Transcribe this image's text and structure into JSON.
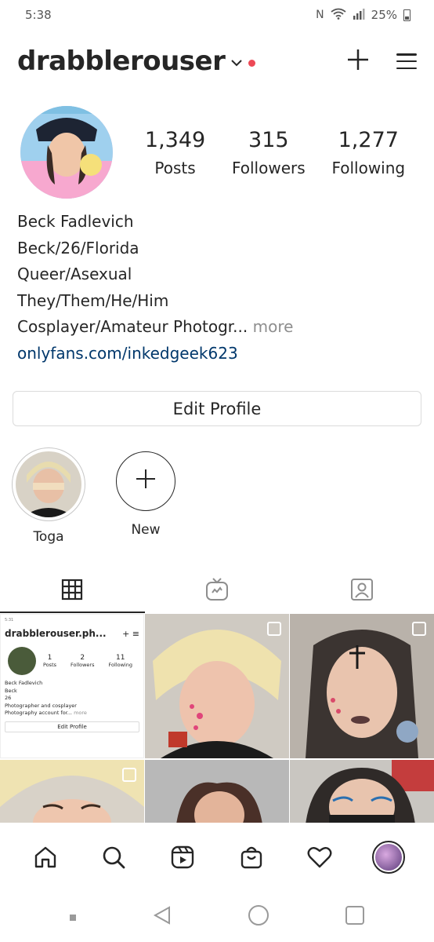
{
  "status_bar": {
    "time": "5:38",
    "battery": "25%",
    "icons": [
      "nfc-icon",
      "wifi-icon",
      "signal-icon",
      "battery-icon"
    ]
  },
  "header": {
    "username": "drabblerouser",
    "actions": [
      "new-post-icon",
      "menu-icon"
    ]
  },
  "profile": {
    "stats": [
      {
        "value": "1,349",
        "label": "Posts"
      },
      {
        "value": "315",
        "label": "Followers"
      },
      {
        "value": "1,277",
        "label": "Following"
      }
    ],
    "bio": {
      "name": "Beck Fadlevich",
      "lines": [
        "Beck/26/Florida",
        "Queer/Asexual",
        "They/Them/He/Him"
      ],
      "truncated_line": "Cosplayer/Amateur Photogr...",
      "more_label": "more",
      "link": "onlyfans.com/inkedgeek623"
    },
    "edit_button_label": "Edit Profile"
  },
  "highlights": [
    {
      "label": "Toga"
    },
    {
      "label": "New"
    }
  ],
  "tabs": [
    "grid-icon",
    "igtv-icon",
    "tagged-icon"
  ],
  "grid": {
    "mini_post": {
      "status": "5:31",
      "username": "drabblerouser.ph...",
      "stats": [
        {
          "value": "1",
          "label": "Posts"
        },
        {
          "value": "2",
          "label": "Followers"
        },
        {
          "value": "11",
          "label": "Following"
        }
      ],
      "bio": [
        "Beck Fadlevich",
        "Beck",
        "26",
        "Photographer and cosplayer"
      ],
      "bio_truncated": "Photography account for...",
      "more_label": "more",
      "button_label": "Edit Profile"
    }
  },
  "bottom_nav": [
    "home-icon",
    "search-icon",
    "reels-icon",
    "shop-icon",
    "activity-icon",
    "profile-avatar"
  ],
  "colors": {
    "text": "#262626",
    "muted": "#8e8e8e",
    "link": "#00376b",
    "notification": "#ed4956",
    "border": "#dbdbdb"
  }
}
